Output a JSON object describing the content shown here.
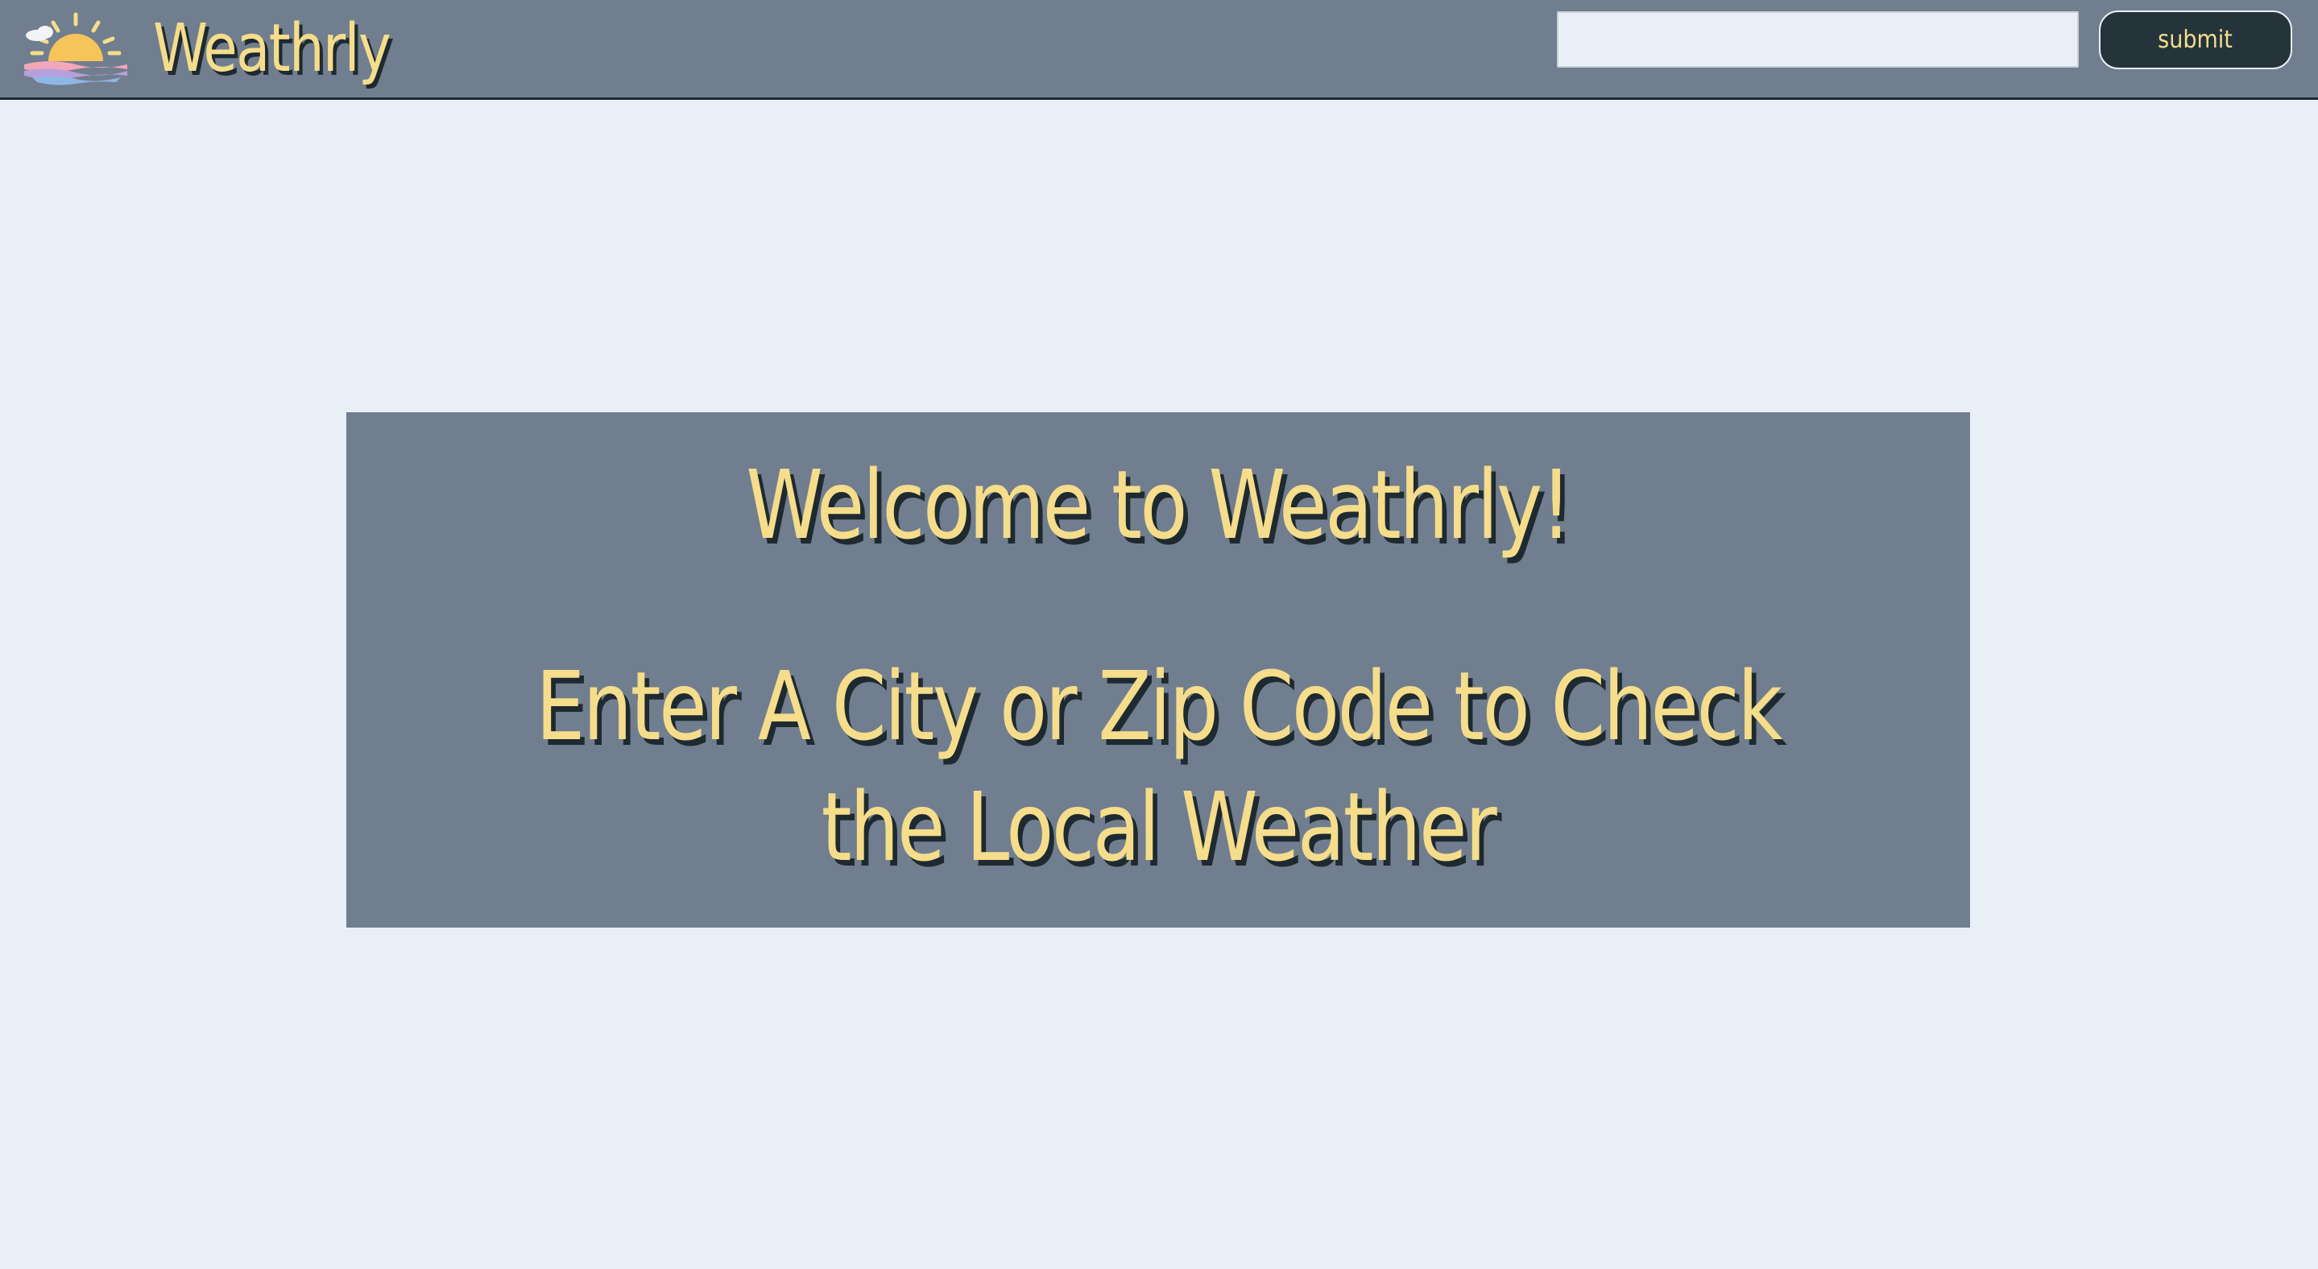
{
  "header": {
    "brand_name": "Weathrly",
    "logo_icon": "sunset-over-water-icon",
    "search": {
      "value": "",
      "placeholder": ""
    },
    "submit_label": "submit"
  },
  "welcome": {
    "title": "Welcome to Weathrly!",
    "subtitle": "Enter A City or Zip Code to Check the Local Weather"
  },
  "colors": {
    "header_bg": "#717e8f",
    "page_bg": "#e8eff6",
    "accent_text": "#f5dd8c",
    "text_shadow": "#1e2a30",
    "button_bg": "#25343b"
  }
}
